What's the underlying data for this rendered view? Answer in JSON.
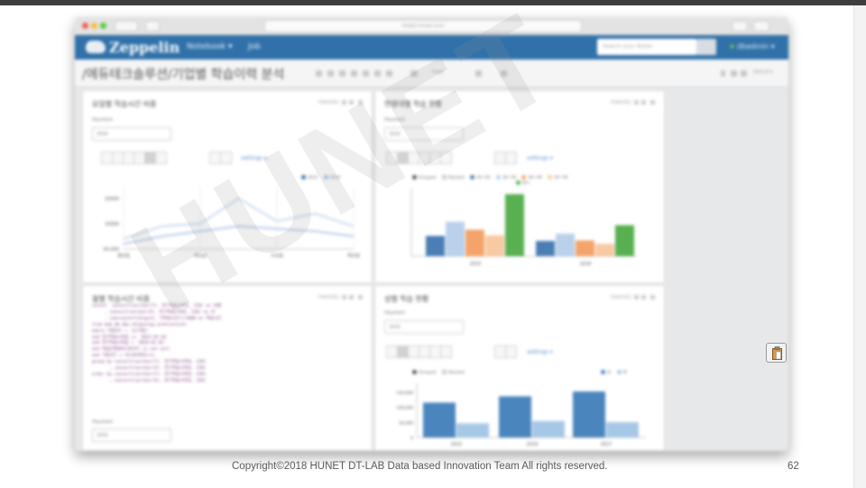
{
  "footer": {
    "copyright": "Copyright©2018 HUNET DT-LAB Data based Innovation Team All rights reserved.",
    "page_number": "62"
  },
  "watermark": "HUNET",
  "browser": {
    "url": "zhidari.hunet.co.kr"
  },
  "app": {
    "logo": "Zeppelin",
    "nav": [
      "Notebook ▾",
      "Job"
    ],
    "search_placeholder": "Search your Notes",
    "user": "dbadmin ▾",
    "accent_color": "#3071a9"
  },
  "notebook": {
    "title": "/에듀테크솔루션/기업별 학습이력 분석",
    "mode": "default ▾",
    "head_label": "head"
  },
  "panels": [
    {
      "title": "요일별 학습시간 비중",
      "status": "FINISHED",
      "input_label": "Haystack",
      "input_value": "3004",
      "settings": "settings ▾",
      "legend": [
        "2015",
        "2016"
      ],
      "y_ticks": [
        "20000",
        "10000",
        "00,000"
      ],
      "x_ticks": [
        "월요일",
        "화요일",
        "수요일",
        "목요일"
      ]
    },
    {
      "title": "연령대별 학습 현황",
      "status": "FINISHED",
      "input_label": "Haystack",
      "input_value": "3004",
      "settings": "settings ▾",
      "legend": [
        "Grouped",
        "Stacked",
        "20~29",
        "30~39",
        "40~49",
        "50~59",
        "60~"
      ],
      "x_ticks": [
        "2015",
        "2016"
      ]
    },
    {
      "title": "월별 학습시간 비중",
      "status": "FINISHED",
      "input_label": "Haystack",
      "input_value": "3004",
      "code": [
        "select  convert(varchar(7), 연구학습시작일, 120) as 년월",
        "     , convert(varchar(4), 연구학습시작일, 120) as 년",
        "     , sum(convert(bigint, 기학습시간))/3600 as 학습시간",
        "from bak_db.dbo.zhigunlog with(nolock)",
        "where 기업코드 = '${기업}'",
        "and 연구학습시작일 >= '2015-01-01'",
        "and 연구학습시작일 < '2018-01-01'",
        "and 학습진행결과구분코드 is not null",
        "and 기업코드 = 히스토리연도(1)",
        "group by convert(varchar(7), 연구학습시작일, 120)",
        "       , convert(varchar(4), 연구학습시작일, 120)",
        "order by convert(varchar(7), 연구학습시작일, 120)",
        "       , convert(varchar(4), 연구학습시작일, 120)"
      ]
    },
    {
      "title": "성별 학습 현황",
      "status": "FINISHED",
      "input_label": "Haystack",
      "input_value": "3004",
      "settings": "settings ▾",
      "legend": [
        "Grouped",
        "Stacked",
        "남",
        "여"
      ],
      "y_ticks": [
        "150,000",
        "100,000",
        "50,000",
        "0"
      ],
      "x_ticks": [
        "2015",
        "2016",
        "2017"
      ]
    }
  ],
  "chart_data": [
    {
      "type": "line",
      "title": "요일별 학습시간 비중",
      "categories": [
        "월요일",
        "",
        "화요일",
        "",
        "수요일",
        "",
        "목요일"
      ],
      "series": [
        {
          "name": "2015",
          "values": [
            4000,
            9000,
            10000,
            20000,
            11000,
            14000,
            9000
          ],
          "color": "#c9daf0"
        },
        {
          "name": "2016",
          "values": [
            2000,
            5000,
            7000,
            9000,
            8000,
            7000,
            5000
          ],
          "color": "#b5cbe6"
        }
      ],
      "ylim": [
        0,
        25000
      ]
    },
    {
      "type": "bar",
      "title": "연령대별 학습 현황",
      "categories": [
        "2015",
        "2016"
      ],
      "series": [
        {
          "name": "20~29",
          "values": [
            36,
            27
          ],
          "color": "#4a7eb5"
        },
        {
          "name": "30~39",
          "values": [
            61,
            40
          ],
          "color": "#b9d1ea"
        },
        {
          "name": "40~49",
          "values": [
            47,
            28
          ],
          "color": "#f4a46a"
        },
        {
          "name": "50~59",
          "values": [
            37,
            22
          ],
          "color": "#f8c9a3"
        },
        {
          "name": "60~",
          "values": [
            110,
            55
          ],
          "color": "#58b050"
        }
      ],
      "ylim": [
        0,
        120
      ]
    },
    {
      "type": "bar",
      "title": "성별 학습 현황",
      "categories": [
        "2015",
        "2016",
        "2017"
      ],
      "series": [
        {
          "name": "남",
          "values": [
            116000,
            137000,
            153000
          ],
          "color": "#4a86bd"
        },
        {
          "name": "여",
          "values": [
            47000,
            55000,
            51000
          ],
          "color": "#a6c8e6"
        }
      ],
      "ylim": [
        0,
        180000
      ]
    }
  ]
}
